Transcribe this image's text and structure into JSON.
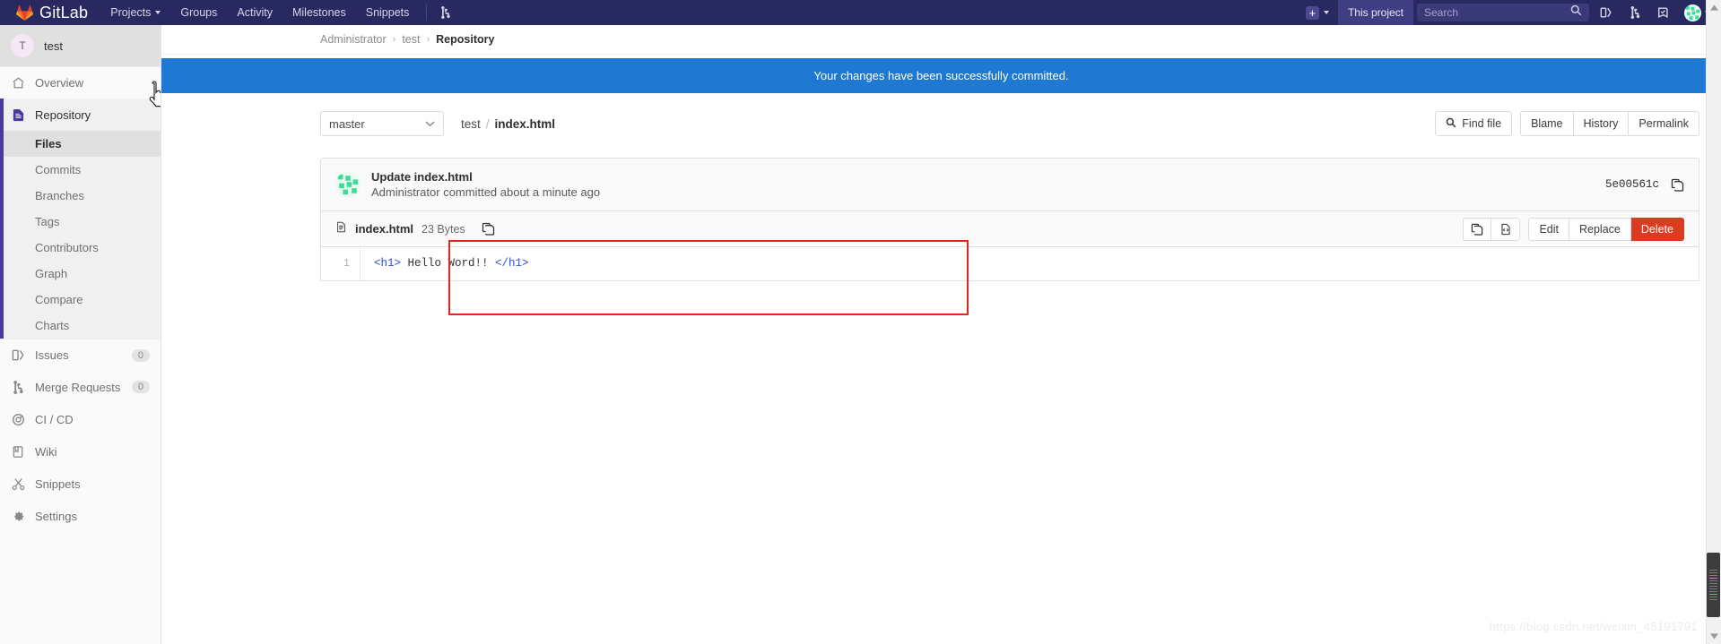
{
  "topnav": {
    "brand": "GitLab",
    "logo_icon": "gitlab-tanuki-logo",
    "links": [
      {
        "label": "Projects",
        "has_caret": true,
        "name": "projects"
      },
      {
        "label": "Groups",
        "has_caret": false,
        "name": "groups"
      },
      {
        "label": "Activity",
        "has_caret": false,
        "name": "activity"
      },
      {
        "label": "Milestones",
        "has_caret": false,
        "name": "milestones"
      },
      {
        "label": "Snippets",
        "has_caret": false,
        "name": "snippets"
      }
    ],
    "branch_icon": "merge-request-icon",
    "plus_label": "+",
    "this_project_label": "This project",
    "search_placeholder": "Search",
    "search_value": "",
    "icons": [
      {
        "name": "issues-icon"
      },
      {
        "name": "merge-requests-icon"
      },
      {
        "name": "todos-icon"
      }
    ],
    "avatar_name": "user-avatar"
  },
  "sidebar": {
    "project": {
      "initial": "T",
      "name": "test"
    },
    "items": [
      {
        "label": "Overview",
        "icon": "home-icon",
        "name": "overview",
        "badge": null,
        "active": false
      },
      {
        "label": "Repository",
        "icon": "document-icon",
        "name": "repository",
        "badge": null,
        "active": true
      }
    ],
    "sub_items": [
      {
        "label": "Files",
        "name": "files",
        "current": true
      },
      {
        "label": "Commits",
        "name": "commits",
        "current": false
      },
      {
        "label": "Branches",
        "name": "branches",
        "current": false
      },
      {
        "label": "Tags",
        "name": "tags",
        "current": false
      },
      {
        "label": "Contributors",
        "name": "contributors",
        "current": false
      },
      {
        "label": "Graph",
        "name": "graph",
        "current": false
      },
      {
        "label": "Compare",
        "name": "compare",
        "current": false
      },
      {
        "label": "Charts",
        "name": "charts",
        "current": false
      }
    ],
    "lower_items": [
      {
        "label": "Issues",
        "icon": "issues-icon",
        "name": "issues",
        "badge": "0"
      },
      {
        "label": "Merge Requests",
        "icon": "merge-requests-icon",
        "name": "merge-requests",
        "badge": "0"
      },
      {
        "label": "CI / CD",
        "icon": "pipeline-icon",
        "name": "ci-cd",
        "badge": null
      },
      {
        "label": "Wiki",
        "icon": "book-icon",
        "name": "wiki",
        "badge": null
      },
      {
        "label": "Snippets",
        "icon": "scissors-icon",
        "name": "snippets",
        "badge": null
      },
      {
        "label": "Settings",
        "icon": "gear-icon",
        "name": "settings",
        "badge": null
      }
    ]
  },
  "breadcrumb": {
    "items": [
      {
        "label": "Administrator",
        "current": false
      },
      {
        "label": "test",
        "current": false
      },
      {
        "label": "Repository",
        "current": true
      }
    ],
    "separator": "›"
  },
  "flash": {
    "message": "Your changes have been successfully committed.",
    "background": "#1f78d1"
  },
  "toolbar": {
    "branch": "master",
    "path_root": "test",
    "path_sep": "/",
    "path_file": "index.html",
    "find_file_label": "Find file",
    "find_file_icon": "search-icon",
    "blame_label": "Blame",
    "history_label": "History",
    "permalink_label": "Permalink"
  },
  "commit": {
    "title": "Update index.html",
    "author": "Administrator",
    "meta_text": "Administrator committed about a minute ago",
    "sha": "5e00561c",
    "copy_icon": "copy-icon",
    "avatar_name": "commit-author-avatar"
  },
  "file": {
    "icon": "file-icon",
    "name": "index.html",
    "size": "23 Bytes",
    "copy_path_icon": "copy-icon",
    "actions": {
      "copy_icon": "copy-contents-icon",
      "raw_icon": "open-raw-icon",
      "edit_label": "Edit",
      "replace_label": "Replace",
      "delete_label": "Delete",
      "delete_color": "#db3b21"
    },
    "lines": [
      {
        "number": "1",
        "segments": [
          {
            "text": "<h1>",
            "kind": "tag"
          },
          {
            "text": " Hello Word!! ",
            "kind": "plain"
          },
          {
            "text": "</h1>",
            "kind": "tag"
          }
        ]
      }
    ]
  },
  "annotation": {
    "name": "red-highlight-box",
    "color": "#e8251c"
  },
  "watermark": {
    "text": "https://blog.csdn.net/weixin_45191791"
  },
  "scrollbar": {
    "up_icon": "scroll-up-arrow",
    "down_icon": "scroll-down-arrow"
  }
}
